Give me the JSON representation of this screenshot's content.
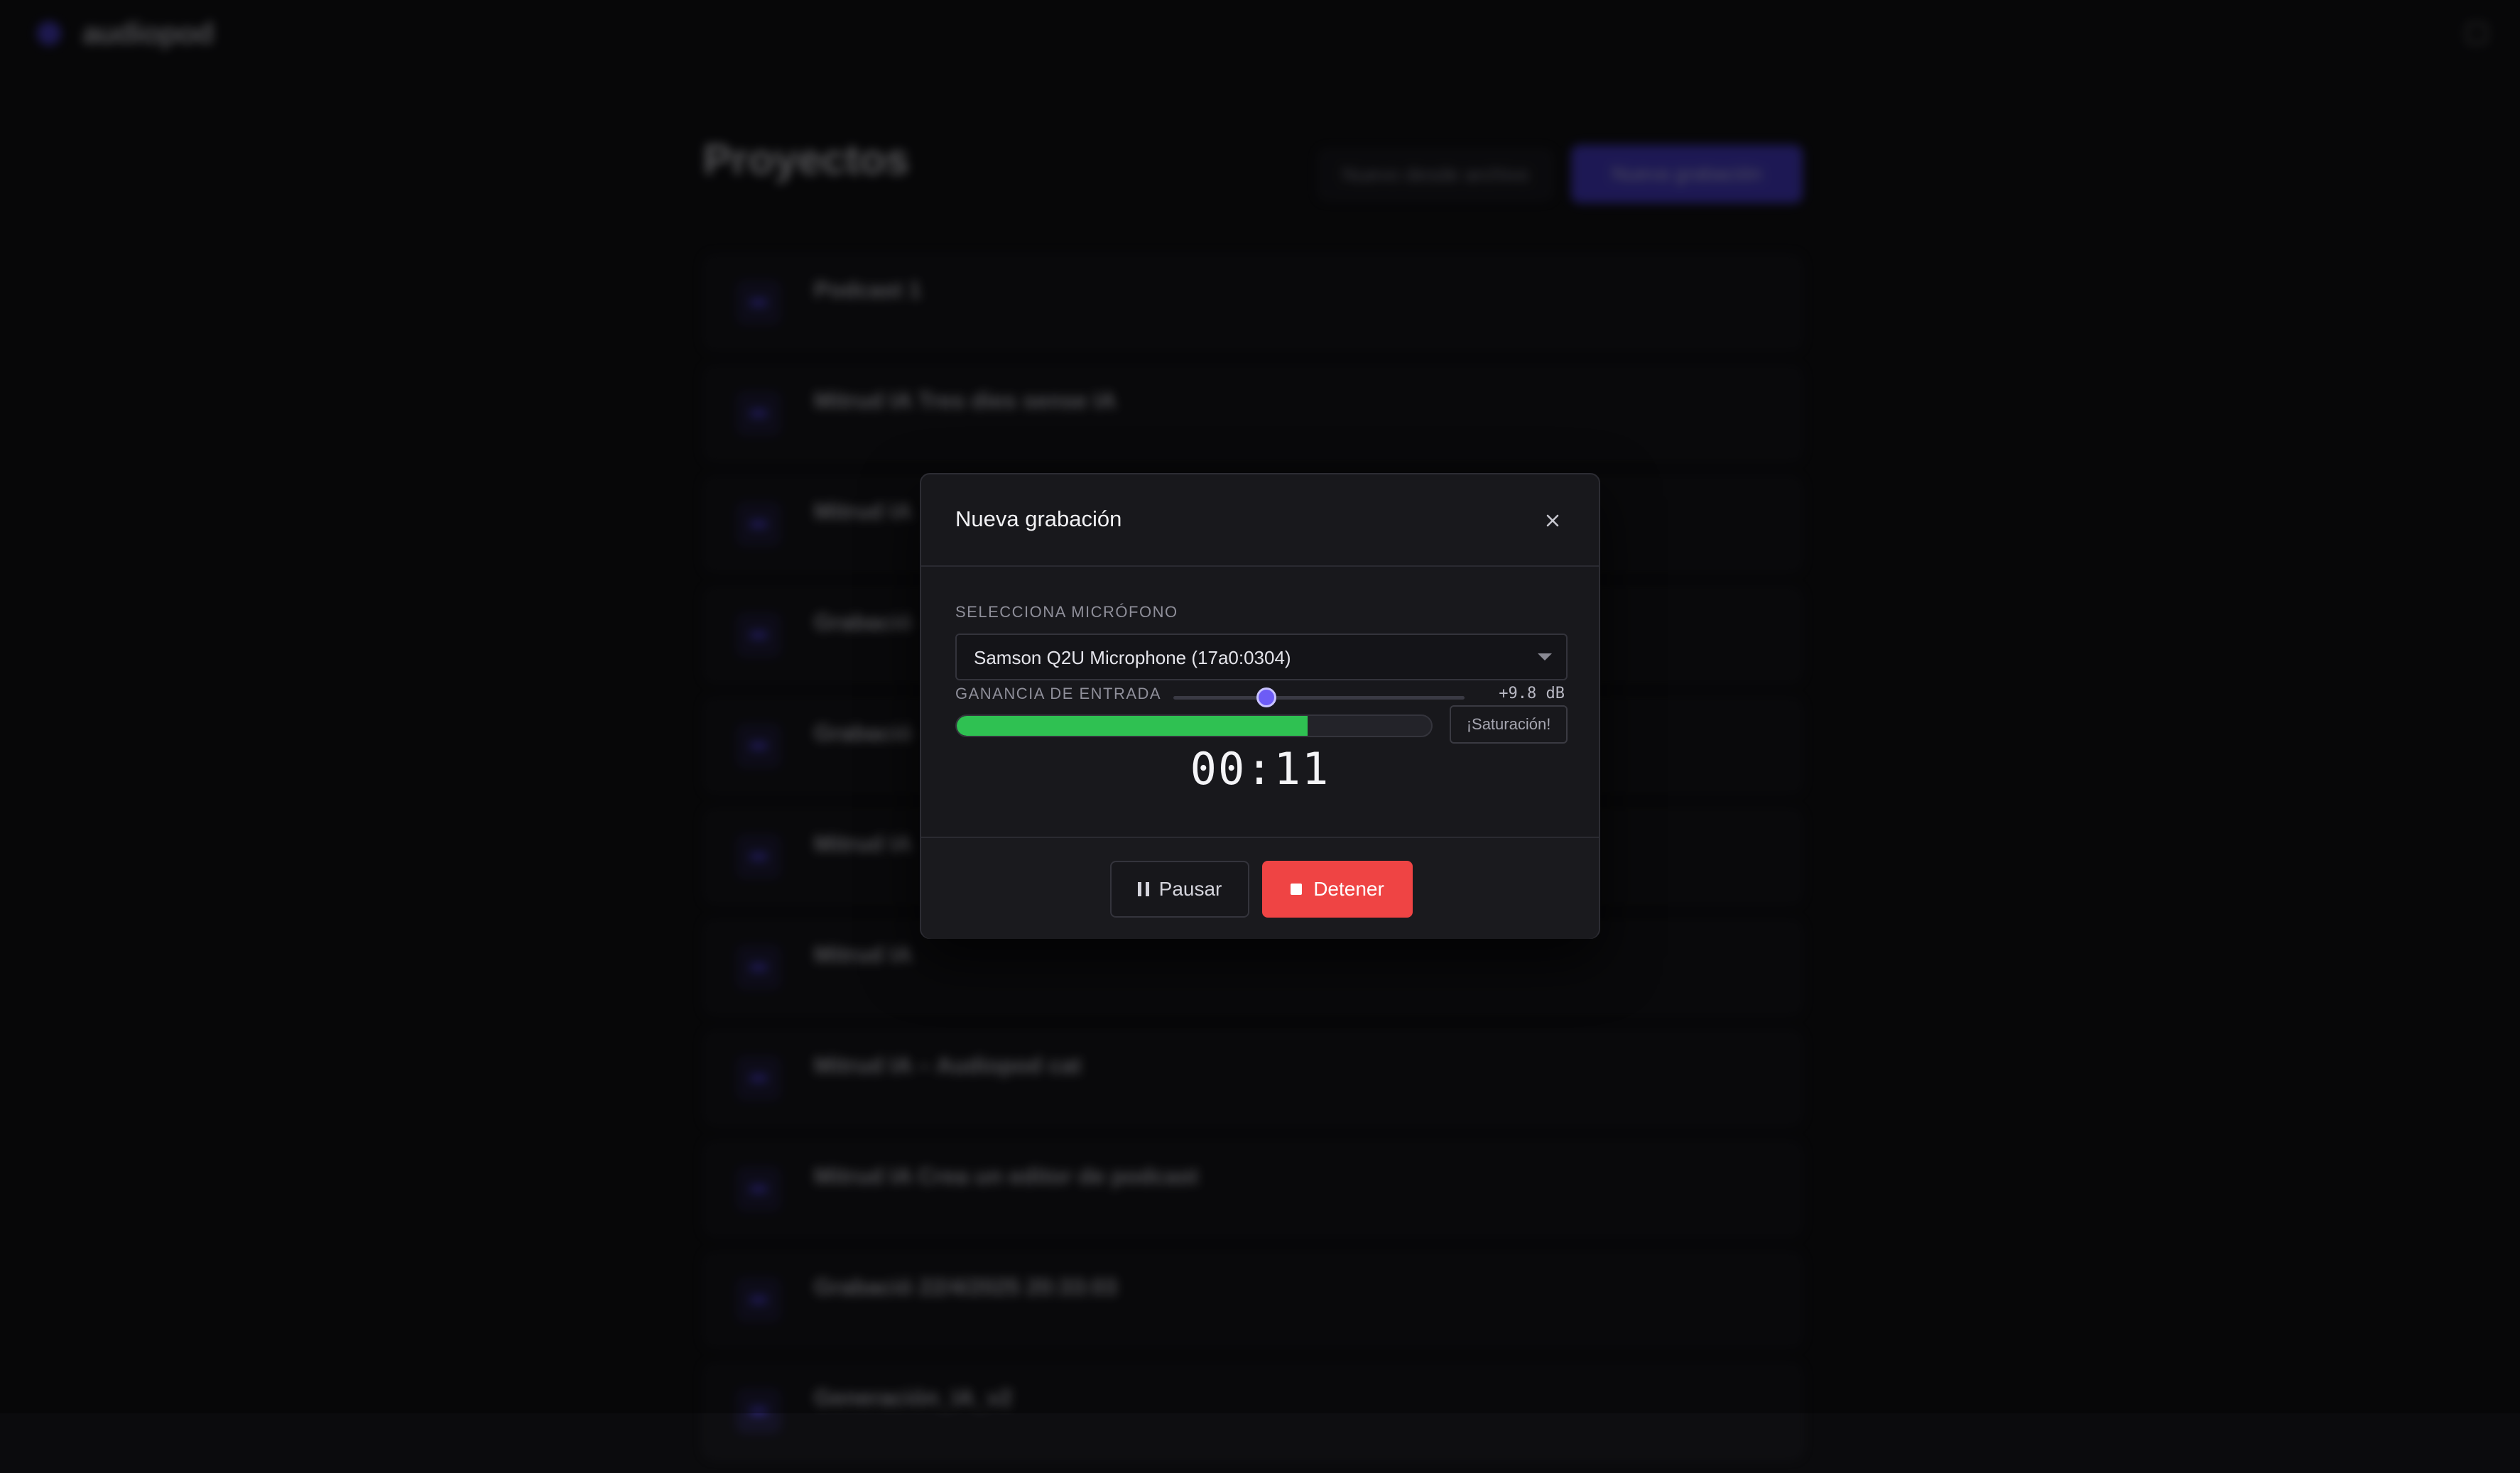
{
  "app": {
    "name": "audiopod"
  },
  "page": {
    "title": "Proyectos",
    "subtitle": "",
    "import_label": "Nuevo desde archivo",
    "new_recording_label": "Nueva grabación"
  },
  "projects": [
    {
      "name": "Podcast 1",
      "meta": ""
    },
    {
      "name": "Mitrud IA Tres dies sense IA",
      "meta": ""
    },
    {
      "name": "Mitrud IA",
      "meta": ""
    },
    {
      "name": "Grabació",
      "meta": ""
    },
    {
      "name": "Grabació",
      "meta": ""
    },
    {
      "name": "Mitrud IA",
      "meta": ""
    },
    {
      "name": "Mitrud IA",
      "meta": ""
    },
    {
      "name": "Mitrud IA – Audiopod cat",
      "meta": ""
    },
    {
      "name": "Mitrud IA Crea un editor de podcast",
      "meta": ""
    },
    {
      "name": "Grabació 22/4/2025 20:33:03",
      "meta": ""
    },
    {
      "name": "Generación_IA_v2",
      "meta": ""
    }
  ],
  "modal": {
    "title": "Nueva grabación",
    "mic_label": "SELECCIONA MICRÓFONO",
    "mic_value": "Samson Q2U Microphone (17a0:0304)",
    "gain_label": "GANANCIA DE ENTRADA",
    "gain_value": "+9.8 dB",
    "gain_level": 0.32,
    "meter_level": 0.74,
    "clip_label": "¡Saturación!",
    "timer": "00:11",
    "pause_label": "Pausar",
    "stop_label": "Detener"
  },
  "colors": {
    "accent": "#6d5cf6",
    "meter": "#2fc152",
    "stop": "#ef4444"
  }
}
